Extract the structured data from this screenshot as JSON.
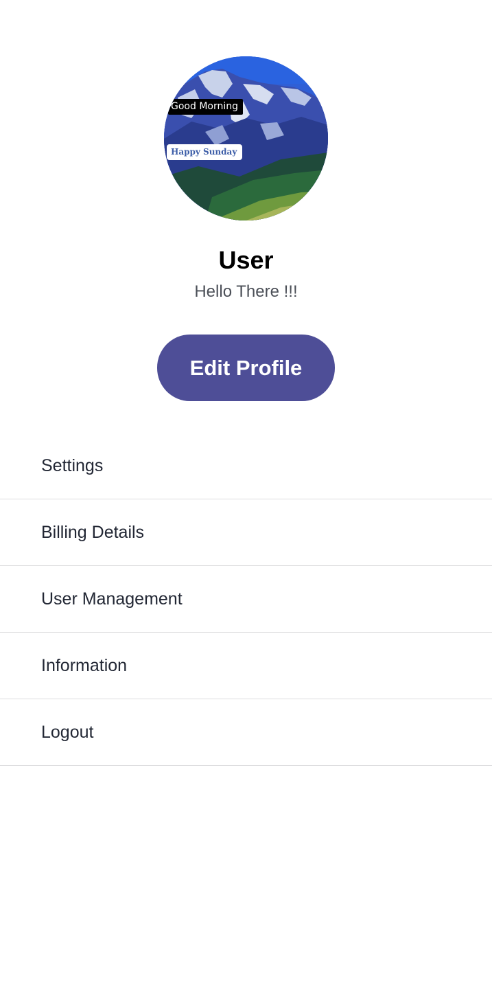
{
  "profile": {
    "avatar": {
      "overlay_top": "Good Morning",
      "overlay_bottom": "Happy Sunday"
    },
    "name": "User",
    "greeting": "Hello There !!!",
    "edit_button_label": "Edit Profile"
  },
  "menu": {
    "items": [
      {
        "label": "Settings"
      },
      {
        "label": "Billing Details"
      },
      {
        "label": "User Management"
      },
      {
        "label": "Information"
      },
      {
        "label": "Logout"
      }
    ]
  },
  "colors": {
    "accent": "#4e4e97",
    "divider": "#dcdcde",
    "text_primary": "#222734",
    "text_secondary": "#4b4f57"
  }
}
